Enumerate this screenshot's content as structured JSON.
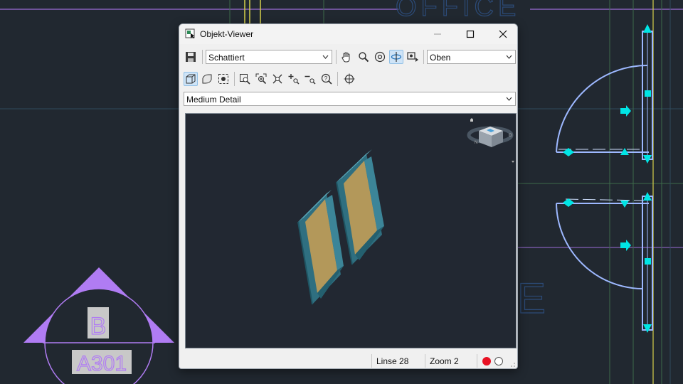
{
  "window": {
    "title": "Objekt-Viewer",
    "minimize_icon": "minimize-icon",
    "maximize_icon": "maximize-icon",
    "close_icon": "close-icon"
  },
  "toolbar1": {
    "visual_style": {
      "selected": "Schattiert"
    },
    "view": {
      "selected": "Oben"
    },
    "tools": [
      "save-icon",
      "pan-icon",
      "zoom-icon",
      "orbit-icon",
      "constrained-orbit-icon",
      "camera-icon"
    ]
  },
  "toolbar2": {
    "tools": [
      "box-view-icon",
      "smooth-view-icon",
      "camera-target-icon",
      "zoom-window-icon",
      "zoom-realtime-icon",
      "zoom-extents-icon",
      "zoom-in-icon",
      "zoom-out-icon",
      "zoom-help-icon",
      "center-target-icon"
    ]
  },
  "detail": {
    "selected": "Medium Detail"
  },
  "status": {
    "linse": "Linse 28",
    "zoom": "Zoom 2",
    "record_color": "#e81123"
  },
  "drawing": {
    "office_label": "OFFICE",
    "section_letter": "B",
    "sheet_ref": "A301",
    "accent_purple": "#b07cf3",
    "cyan": "#00e5e5"
  }
}
